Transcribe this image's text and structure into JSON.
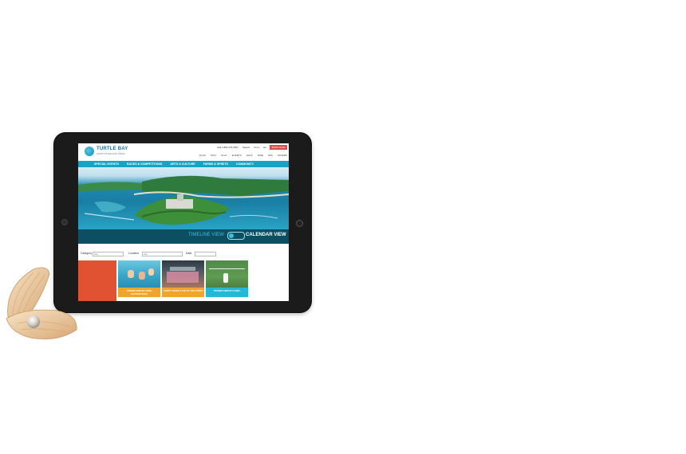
{
  "site": {
    "logo_text": "TURTLE BAY",
    "logo_sub": "NORTH SHORE OAHU HAWAII",
    "utility": [
      "Call 1.866.475.2567",
      "Search",
      "From",
      "En"
    ],
    "book_label": "BOOK NOW",
    "top_nav": [
      "PLAN",
      "STAY",
      "PLAY",
      "EVENTS",
      "GOLF",
      "DINE",
      "SPA",
      "OFFERS"
    ]
  },
  "category_bar": [
    "SPECIAL EVENTS",
    "RACES & COMPETITIONS",
    "ARTS & CULTURE",
    "FARMS & SPIRITS",
    "COMMUNITY"
  ],
  "view_toggle": {
    "timeline_label": "TIMELINE VIEW",
    "calendar_label": "CALENDAR VIEW"
  },
  "filters": {
    "category_label": "Category",
    "category_value": "Any",
    "location_label": "Location",
    "location_value": "Any",
    "date_label": "Date",
    "date_value": ""
  },
  "cards": [
    {
      "caption": "SPRING BREAK KEIKI ADVENTURES",
      "color": "#f0a52a"
    },
    {
      "caption": "THIRTY MANA LIVE AT THE POINT",
      "color": "#f0a52a"
    },
    {
      "caption": "TENNIS GROUP CLINIC",
      "color": "#22b8d6"
    }
  ]
}
